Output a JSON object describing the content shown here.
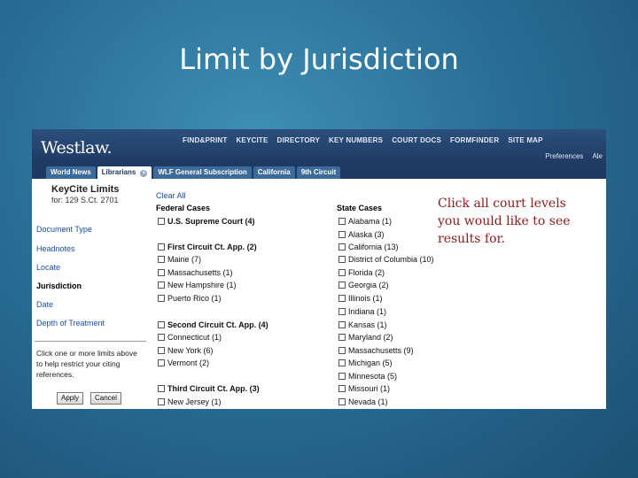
{
  "slide": {
    "title": "Limit by Jurisdiction"
  },
  "header": {
    "logo": "Westlaw.",
    "nav": [
      "FIND&PRINT",
      "KEYCITE",
      "DIRECTORY",
      "KEY NUMBERS",
      "COURT DOCS",
      "FORMFINDER",
      "SITE MAP"
    ],
    "right_links": [
      "Preferences",
      "Ale"
    ]
  },
  "tabs": [
    {
      "label": "World News"
    },
    {
      "label": "Librarians"
    },
    {
      "label": "WLF General Subscription"
    },
    {
      "label": "California"
    },
    {
      "label": "9th Circuit"
    }
  ],
  "sidebar": {
    "title": "KeyCite Limits",
    "subtitle": "for: 129 S.Ct. 2701",
    "links": [
      "Document Type",
      "Headnotes",
      "Locate",
      "Jurisdiction",
      "Date",
      "Depth of Treatment"
    ],
    "current_link": "Jurisdiction",
    "help_text": "Click one or more limits above to help restrict your citing references.",
    "apply_label": "Apply",
    "cancel_label": "Cancel"
  },
  "main": {
    "clear_all": "Clear All",
    "federal": {
      "heading": "Federal Cases",
      "items": [
        {
          "label": "U.S. Supreme Court (4)",
          "bold": true
        },
        {
          "label": "First Circuit Ct. App. (2)",
          "bold": true
        },
        {
          "label": "Maine (7)"
        },
        {
          "label": "Massachusetts (1)"
        },
        {
          "label": "New Hampshire (1)"
        },
        {
          "label": "Puerto Rico (1)"
        },
        {
          "label": "Second Circuit Ct. App. (4)",
          "bold": true
        },
        {
          "label": "Connecticut (1)"
        },
        {
          "label": "New York (6)"
        },
        {
          "label": "Vermont (2)"
        },
        {
          "label": "Third Circuit Ct. App. (3)",
          "bold": true
        },
        {
          "label": "New Jersey (1)"
        }
      ]
    },
    "state": {
      "heading": "State Cases",
      "items": [
        {
          "label": "Alabama (1)"
        },
        {
          "label": "Alaska (3)"
        },
        {
          "label": "California (13)"
        },
        {
          "label": "District of Columbia (10)"
        },
        {
          "label": "Florida (2)"
        },
        {
          "label": "Georgia (2)"
        },
        {
          "label": "Illinois (1)"
        },
        {
          "label": "Indiana (1)"
        },
        {
          "label": "Kansas (1)"
        },
        {
          "label": "Maryland (2)"
        },
        {
          "label": "Massachusetts (9)"
        },
        {
          "label": "Michigan (5)"
        },
        {
          "label": "Minnesota (5)"
        },
        {
          "label": "Missouri (1)"
        },
        {
          "label": "Nevada (1)"
        }
      ]
    },
    "note": "Click all court levels you would like to see results for."
  }
}
